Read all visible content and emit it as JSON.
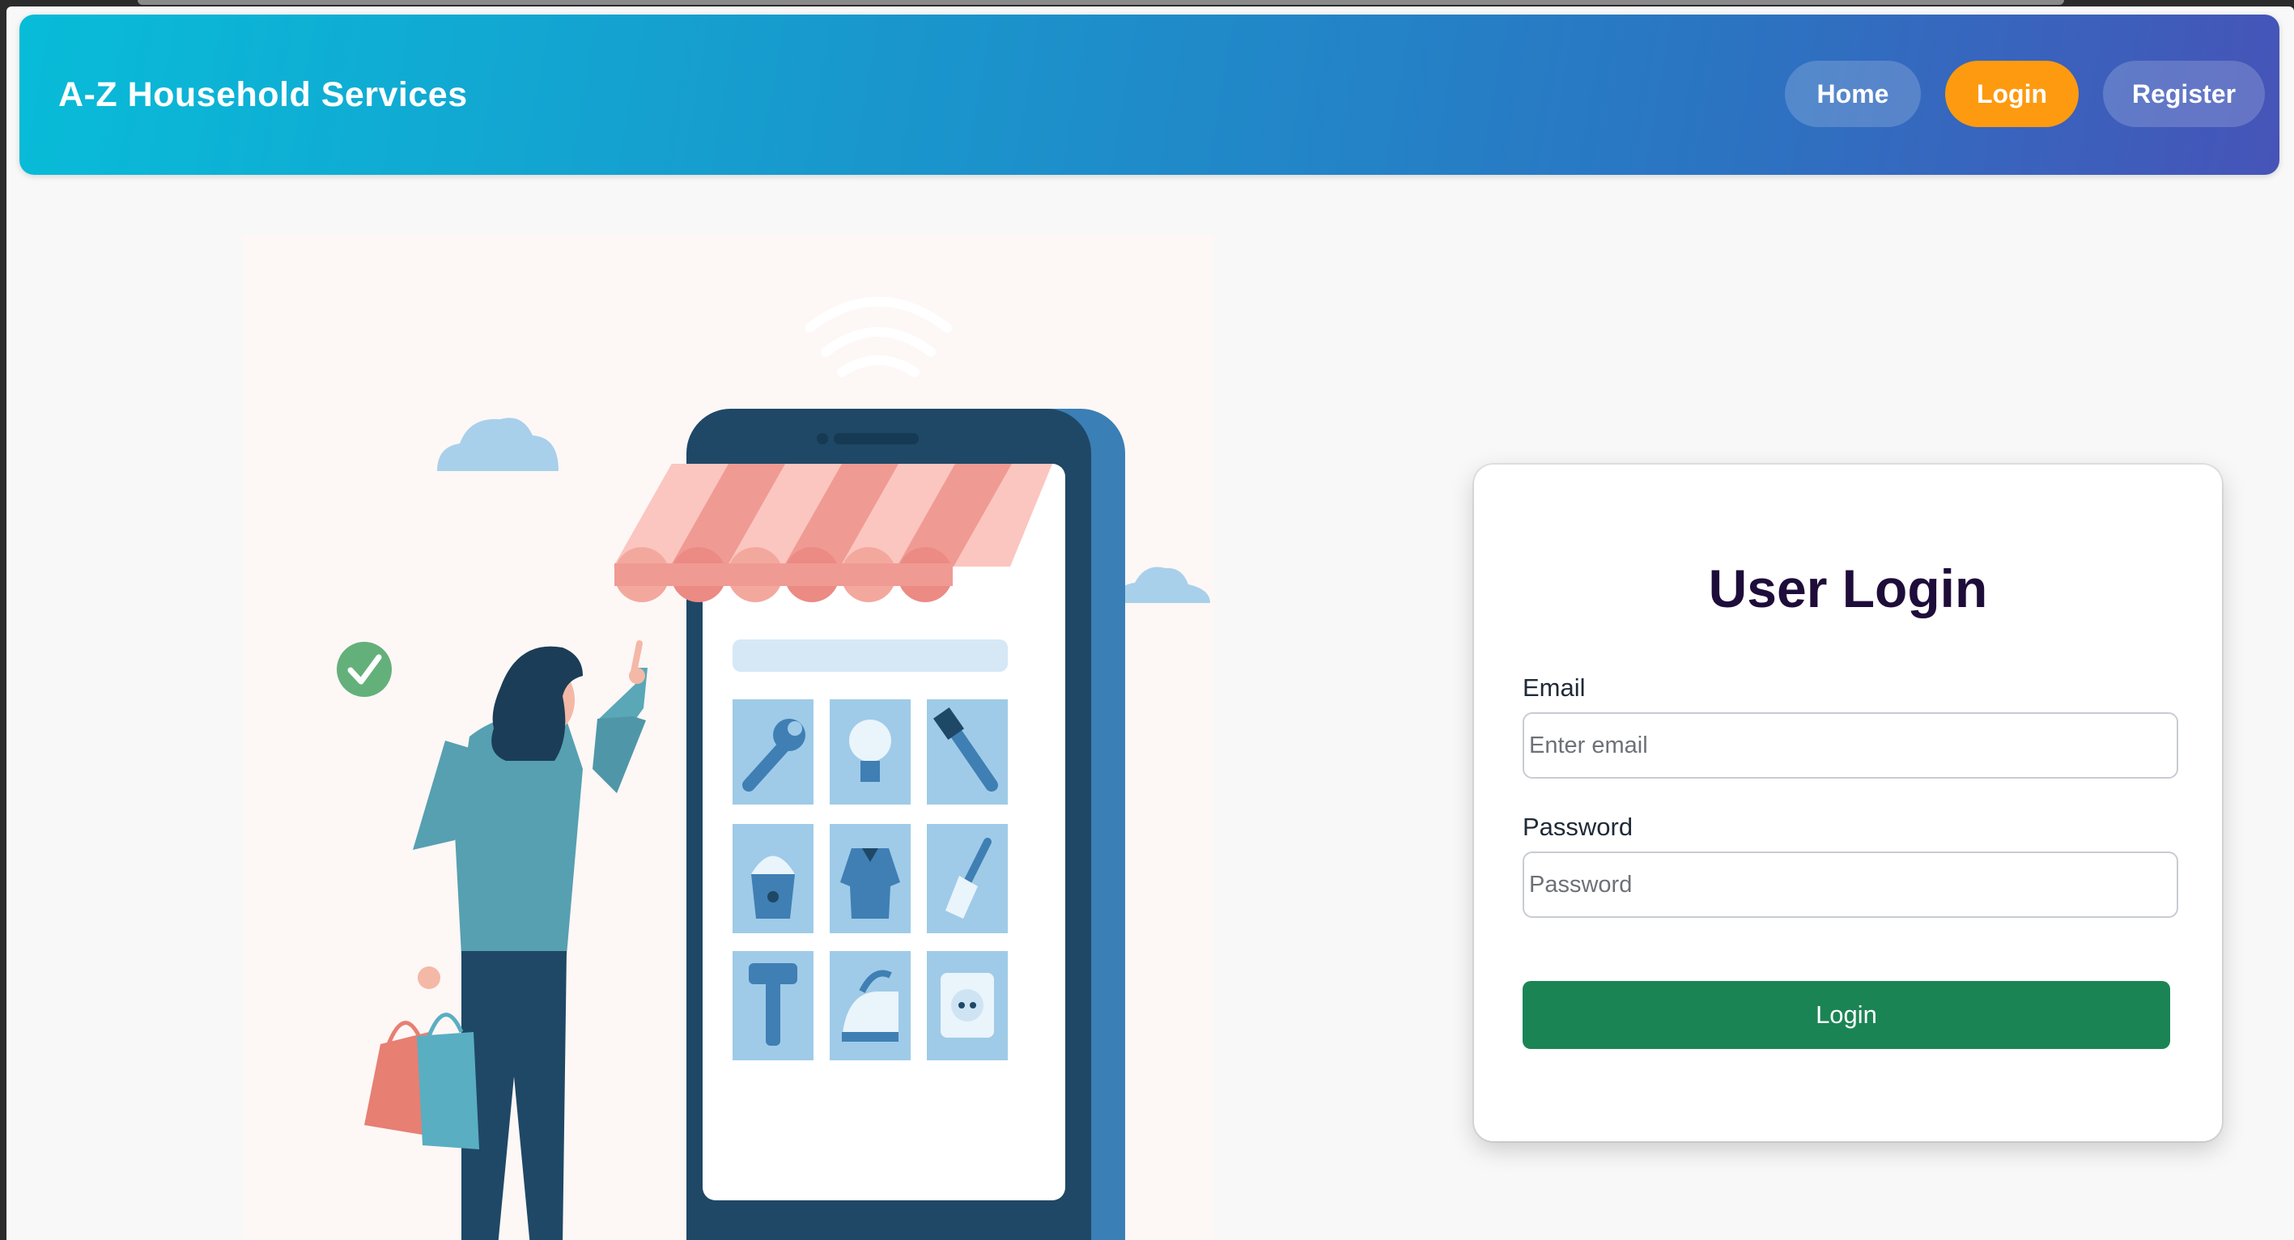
{
  "navbar": {
    "brand": "A-Z Household Services",
    "links": {
      "home": "Home",
      "login": "Login",
      "register": "Register"
    },
    "active": "login"
  },
  "login_card": {
    "title": "User Login",
    "email_label": "Email",
    "email_placeholder": "Enter email",
    "email_value": "",
    "password_label": "Password",
    "password_placeholder": "Password",
    "password_value": "",
    "submit_label": "Login"
  },
  "colors": {
    "active_nav": "#fd9a10",
    "submit": "#1b8454",
    "title": "#1e0d3a"
  },
  "icons": [
    "wrench-icon",
    "lightbulb-icon",
    "screwdriver-icon",
    "bucket-icon",
    "shirt-icon",
    "broom-icon",
    "hammer-icon",
    "iron-icon",
    "power-socket-icon",
    "checkmark-icon",
    "wifi-icon",
    "cloud-icon"
  ]
}
